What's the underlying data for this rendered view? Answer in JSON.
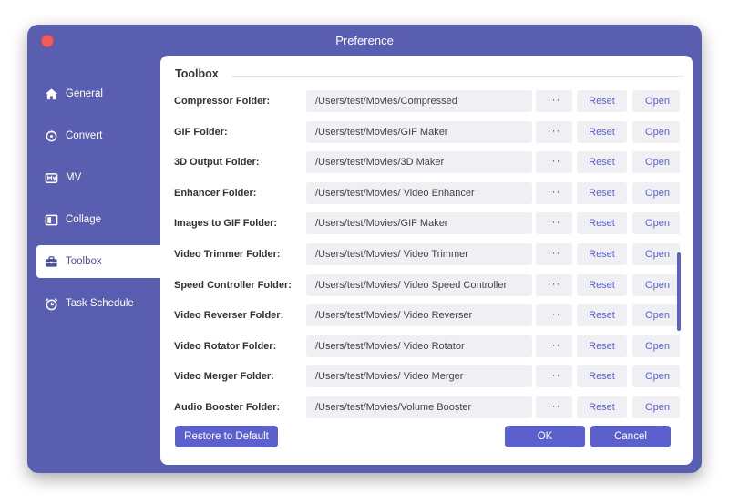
{
  "window": {
    "title": "Preference"
  },
  "sidebar": {
    "items": [
      {
        "label": "General",
        "icon": "home-icon"
      },
      {
        "label": "Convert",
        "icon": "convert-icon"
      },
      {
        "label": "MV",
        "icon": "mv-icon"
      },
      {
        "label": "Collage",
        "icon": "collage-icon"
      },
      {
        "label": "Toolbox",
        "icon": "toolbox-icon",
        "active": true
      },
      {
        "label": "Task Schedule",
        "icon": "alarm-clock-icon"
      }
    ]
  },
  "section": {
    "title": "Toolbox"
  },
  "rows": [
    {
      "label": "Compressor Folder:",
      "path": "/Users/test/Movies/Compressed"
    },
    {
      "label": "GIF Folder:",
      "path": "/Users/test/Movies/GIF Maker"
    },
    {
      "label": "3D Output Folder:",
      "path": "/Users/test/Movies/3D Maker"
    },
    {
      "label": "Enhancer Folder:",
      "path": "/Users/test/Movies/ Video Enhancer"
    },
    {
      "label": "Images to GIF Folder:",
      "path": "/Users/test/Movies/GIF Maker"
    },
    {
      "label": "Video Trimmer Folder:",
      "path": "/Users/test/Movies/ Video Trimmer"
    },
    {
      "label": "Speed Controller Folder:",
      "path": "/Users/test/Movies/ Video Speed Controller"
    },
    {
      "label": "Video Reverser Folder:",
      "path": "/Users/test/Movies/ Video Reverser"
    },
    {
      "label": "Video Rotator Folder:",
      "path": "/Users/test/Movies/ Video Rotator"
    },
    {
      "label": "Video Merger Folder:",
      "path": "/Users/test/Movies/ Video Merger"
    },
    {
      "label": "Audio Booster Folder:",
      "path": "/Users/test/Movies/Volume Booster"
    }
  ],
  "row_buttons": {
    "dots": "···",
    "reset": "Reset",
    "open": "Open"
  },
  "footer": {
    "restore": "Restore to Default",
    "ok": "OK",
    "cancel": "Cancel"
  },
  "colors": {
    "accent": "#5b60cc",
    "window_bg": "#5a5eb0",
    "field_bg": "#efeff4",
    "close": "#ee5d5a"
  }
}
